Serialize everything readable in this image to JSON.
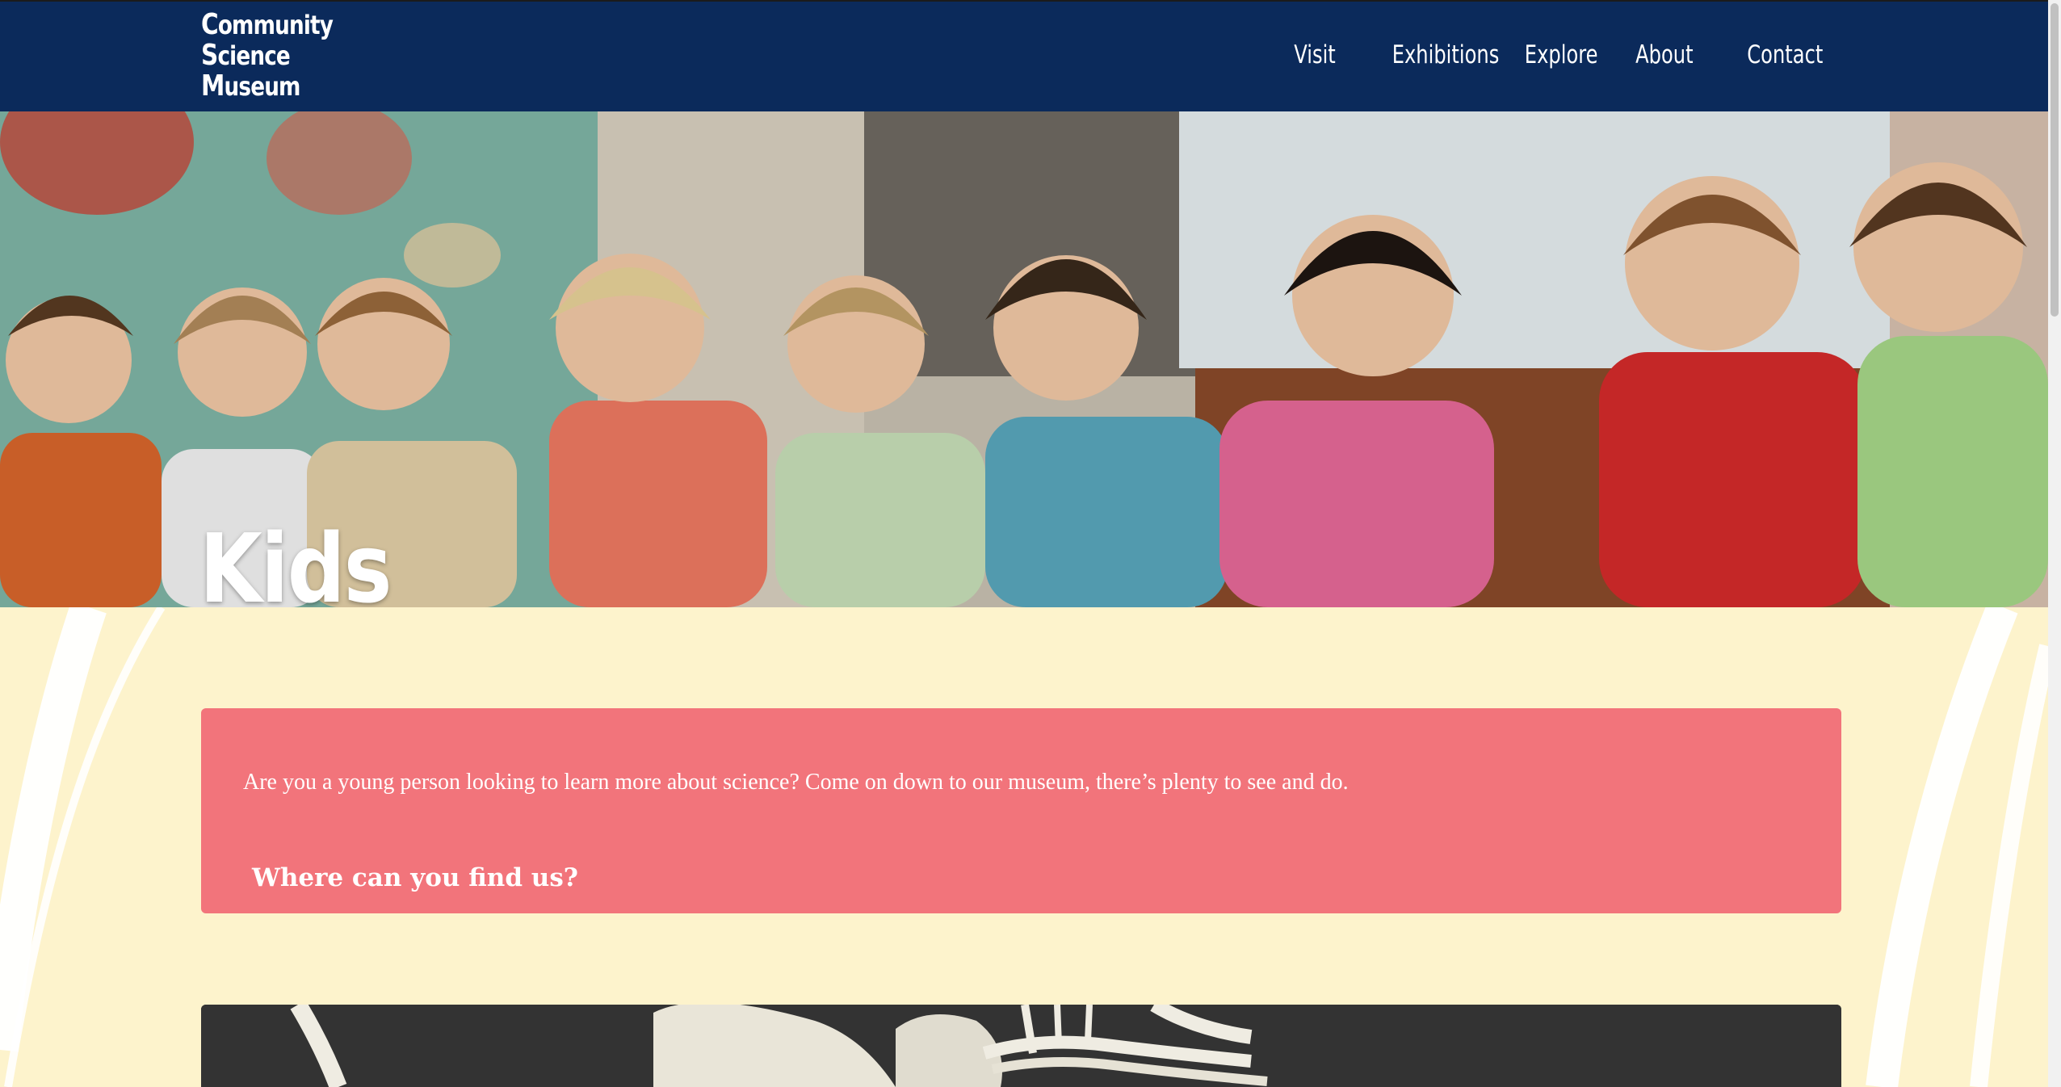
{
  "header": {
    "logo": {
      "line1_cap": "C",
      "line1_rest": "ommunity",
      "line2_cap": "S",
      "line2_rest": "cience",
      "line3_cap": "M",
      "line3_rest": "useum"
    },
    "nav": {
      "visit": "Visit",
      "exhibitions": "Exhibitions",
      "explore": "Explore",
      "about": "About",
      "contact": "Contact"
    }
  },
  "hero": {
    "title": "Kids"
  },
  "info": {
    "text": "Are you a young person looking to learn more about science? Come on down to our museum, there’s plenty to see and do.",
    "heading": "Where can you find us?"
  },
  "colors": {
    "header_bg": "#0b2a5b",
    "page_bg": "#fdf3cc",
    "card_bg": "#f2747b"
  }
}
